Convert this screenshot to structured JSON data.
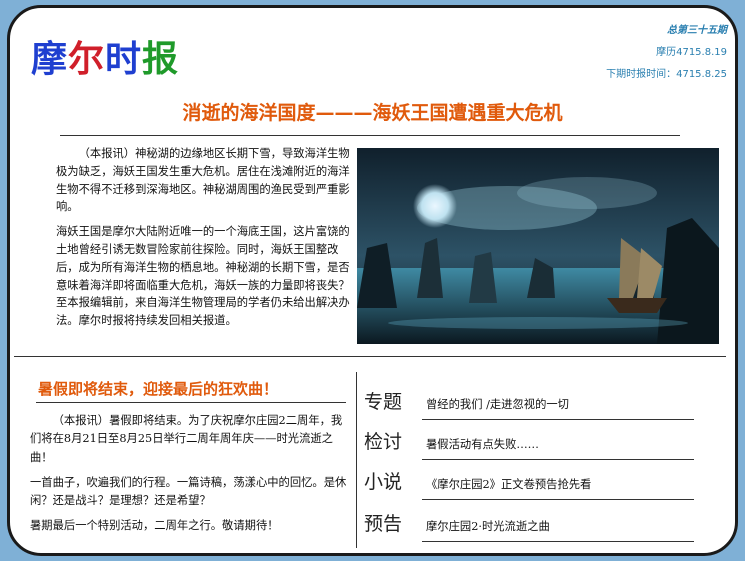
{
  "masthead": {
    "c1": "摩",
    "c2": "尔",
    "c3": "时",
    "c4": "报"
  },
  "issue": {
    "number": "总第三十五期",
    "date": "摩历4715.8.19",
    "next": "下期时报时间：4715.8.25"
  },
  "headline": "消逝的海洋国度———海妖王国遭遇重大危机",
  "story1": {
    "p1": "（本报讯）神秘湖的边缘地区长期下雪，导致海洋生物极为缺乏，海妖王国发生重大危机。居住在浅滩附近的海洋生物不得不迁移到深海地区。神秘湖周围的渔民受到严重影响。",
    "p2": "海妖王国是摩尔大陆附近唯一的一个海底王国，这片富饶的土地曾经引诱无数冒险家前往探险。同时，海妖王国整改后，成为所有海洋生物的栖息地。神秘湖的长期下雪，是否意味着海洋即将面临重大危机，海妖一族的力量即将丧失？至本报编辑前，来自海洋生物管理局的学者仍未给出解决办法。摩尔时报将持续发回相关报道。"
  },
  "colors": {
    "headline": "#e05a0c",
    "masthead_blue": "#1f3fd0",
    "masthead_red": "#d01f2a",
    "masthead_green": "#1f9a2a",
    "issue": "#2a7fb0",
    "frame": "#7fb0d6"
  },
  "story2": {
    "title": "暑假即将结束，迎接最后的狂欢曲！",
    "p1": "（本报讯）暑假即将结束。为了庆祝摩尔庄园2二周年，我们将在8月21日至8月25日举行二周年周年庆——时光流逝之曲！",
    "p2": "一首曲子，吹遍我们的行程。一篇诗稿，荡漾心中的回忆。是休闲？还是战斗？是理想？还是希望？",
    "p3": "暑期最后一个特别活动，二周年之行。敬请期待！"
  },
  "toc": [
    {
      "label": "专题",
      "text": "曾经的我们 /走进忽视的一切"
    },
    {
      "label": "检讨",
      "text": "暑假活动有点失败……"
    },
    {
      "label": "小说",
      "text": "《摩尔庄园2》正文卷预告抢先看"
    },
    {
      "label": "预告",
      "text": "摩尔庄园2·时光流逝之曲"
    }
  ]
}
